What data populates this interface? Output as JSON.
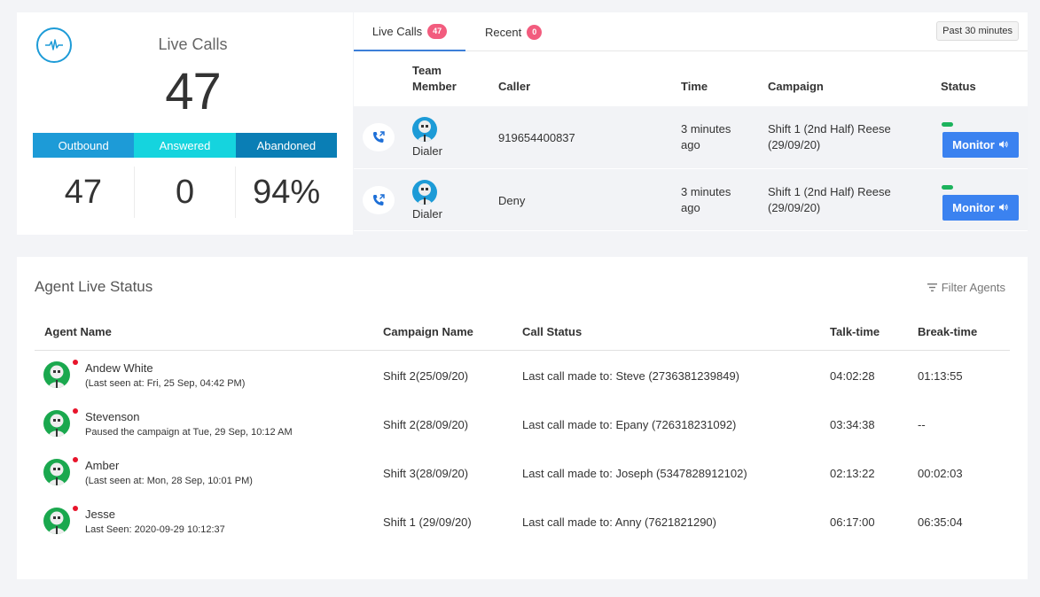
{
  "summary": {
    "title": "Live Calls",
    "count": "47",
    "metrics": [
      {
        "label": "Outbound",
        "value": "47"
      },
      {
        "label": "Answered",
        "value": "0"
      },
      {
        "label": "Abandoned",
        "value": "94%"
      }
    ],
    "icon": "pulse-icon"
  },
  "calls": {
    "tabs": [
      {
        "label": "Live Calls",
        "badge": "47"
      },
      {
        "label": "Recent",
        "badge": "0"
      }
    ],
    "time_filter": "Past 30 minutes",
    "columns": [
      "Team Member",
      "Caller",
      "Time",
      "Campaign",
      "Status"
    ],
    "rows": [
      {
        "member": "Dialer",
        "caller": "919654400837",
        "time": "3 minutes ago",
        "campaign": "Shift 1 (2nd Half) Reese (29/09/20)",
        "action": "Monitor"
      },
      {
        "member": "Dialer",
        "caller": "Deny",
        "time": "3 minutes ago",
        "campaign": "Shift 1 (2nd Half) Reese (29/09/20)",
        "action": "Monitor"
      }
    ]
  },
  "agents": {
    "title": "Agent Live Status",
    "filter_label": "Filter Agents",
    "columns": [
      "Agent Name",
      "Campaign Name",
      "Call Status",
      "Talk-time",
      "Break-time"
    ],
    "rows": [
      {
        "name": "Andew White",
        "sub": "(Last seen at: Fri, 25 Sep, 04:42 PM)",
        "campaign": "Shift 2(25/09/20)",
        "status": "Last call made to: Steve (2736381239849)",
        "talk": "04:02:28",
        "break": "01:13:55"
      },
      {
        "name": "Stevenson",
        "sub": "Paused the campaign at Tue, 29 Sep, 10:12 AM",
        "campaign": "Shift 2(28/09/20)",
        "status": "Last call made to: Epany (726318231092)",
        "talk": "03:34:38",
        "break": "--"
      },
      {
        "name": "Amber",
        "sub": "(Last seen at: Mon, 28 Sep, 10:01 PM)",
        "campaign": "Shift 3(28/09/20)",
        "status": "Last call made to: Joseph (5347828912102)",
        "talk": "02:13:22",
        "break": "00:02:03"
      },
      {
        "name": "Jesse",
        "sub": "Last Seen: 2020-09-29 10:12:37",
        "campaign": "Shift 1 (29/09/20)",
        "status": "Last call made to: Anny (7621821290)",
        "talk": "06:17:00",
        "break": "06:35:04"
      }
    ]
  },
  "colors": {
    "outbound": "#1d9bd7",
    "answered": "#15d4de",
    "abandoned": "#0a7eb5",
    "badge": "#f25c7e",
    "monitor_button": "#3b82f0",
    "active_status": "#1db35d",
    "online_dot": "#e8142b",
    "agent_avatar": "#1aa84e"
  }
}
